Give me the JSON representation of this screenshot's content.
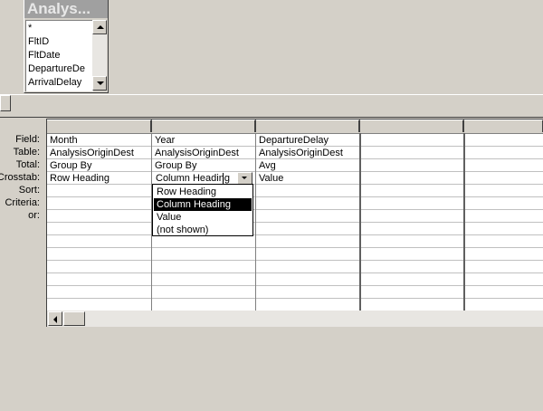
{
  "table_box": {
    "title": "Analys...",
    "fields": [
      "*",
      "FltID",
      "FltDate",
      "DepartureDe",
      "ArrivalDelay"
    ]
  },
  "row_labels": {
    "field": "Field:",
    "table": "Table:",
    "total": "Total:",
    "crosstab": "Crosstab:",
    "sort": "Sort:",
    "criteria": "Criteria:",
    "or": "or:"
  },
  "columns": [
    {
      "field": "Month",
      "table": "AnalysisOriginDest",
      "total": "Group By",
      "crosstab": "Row Heading"
    },
    {
      "field": "Year",
      "table": "AnalysisOriginDest",
      "total": "Group By",
      "crosstab": "Column Heading"
    },
    {
      "field": "DepartureDelay",
      "table": "AnalysisOriginDest",
      "total": "Avg",
      "crosstab": "Value"
    },
    {
      "field": "",
      "table": "",
      "total": "",
      "crosstab": ""
    },
    {
      "field": "",
      "table": "",
      "total": "",
      "crosstab": ""
    }
  ],
  "crosstab_dropdown": {
    "options": [
      "Row Heading",
      "Column Heading",
      "Value",
      "(not shown)"
    ],
    "selected": "Column Heading"
  },
  "colors": {
    "selection_bg": "#000000",
    "window_bg": "#d4d0c8"
  }
}
